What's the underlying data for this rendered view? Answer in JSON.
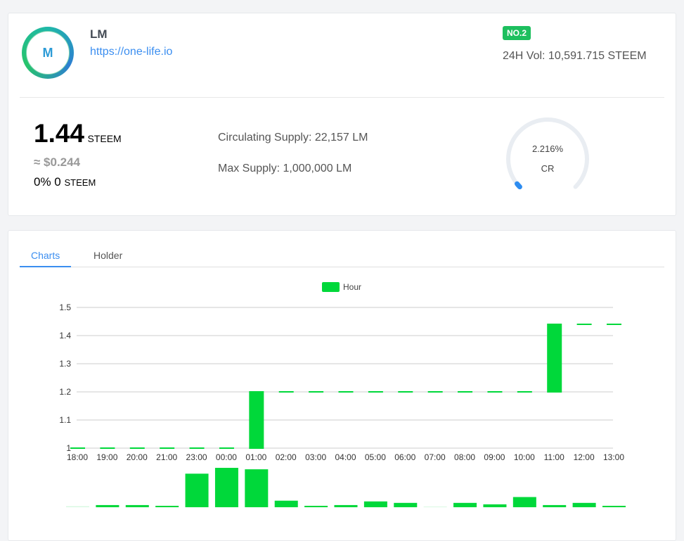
{
  "token": {
    "name": "LM",
    "url": "https://one-life.io",
    "rank": "NO.2",
    "vol24h": "24H Vol: 10,591.715 STEEM",
    "logo_text": "M"
  },
  "price": {
    "value": "1.44",
    "unit": "STEEM",
    "usd": "≈ $0.244",
    "change": "0% 0",
    "change_unit": "STEEM"
  },
  "supply": {
    "circulating": "Circulating Supply:  22,157 LM",
    "max": "Max Supply:  1,000,000 LM"
  },
  "gauge": {
    "value": "2.216%",
    "label": "CR",
    "fraction": 0.02216,
    "color": "#2d8cf0"
  },
  "tabs": [
    {
      "label": "Charts"
    },
    {
      "label": "Holder"
    }
  ],
  "chart_data": {
    "type": "candlestick",
    "legend": "Hour",
    "legend_placement": "top-center",
    "color": "#00d83a",
    "categories": [
      "18:00",
      "19:00",
      "20:00",
      "21:00",
      "23:00",
      "00:00",
      "01:00",
      "02:00",
      "03:00",
      "04:00",
      "05:00",
      "06:00",
      "07:00",
      "08:00",
      "09:00",
      "10:00",
      "11:00",
      "12:00",
      "13:00"
    ],
    "open": [
      1,
      1,
      1,
      1,
      1,
      1,
      1,
      1.2,
      1.2,
      1.2,
      1.2,
      1.2,
      1.2,
      1.2,
      1.2,
      1.2,
      1.2,
      1.44,
      1.44
    ],
    "close": [
      1,
      1,
      1,
      1,
      1,
      1,
      1.2,
      1.2,
      1.2,
      1.2,
      1.2,
      1.2,
      1.2,
      1.2,
      1.2,
      1.2,
      1.44,
      1.44,
      1.44
    ],
    "volume_relative": [
      0.5,
      2,
      2,
      1,
      45,
      53,
      51,
      8,
      1,
      2,
      7,
      5,
      0,
      5,
      3,
      13,
      2,
      5,
      1
    ],
    "yticks": [
      "1",
      "1.1",
      "1.2",
      "1.3",
      "1.4",
      "1.5"
    ],
    "ylim": [
      1,
      1.5
    ]
  }
}
